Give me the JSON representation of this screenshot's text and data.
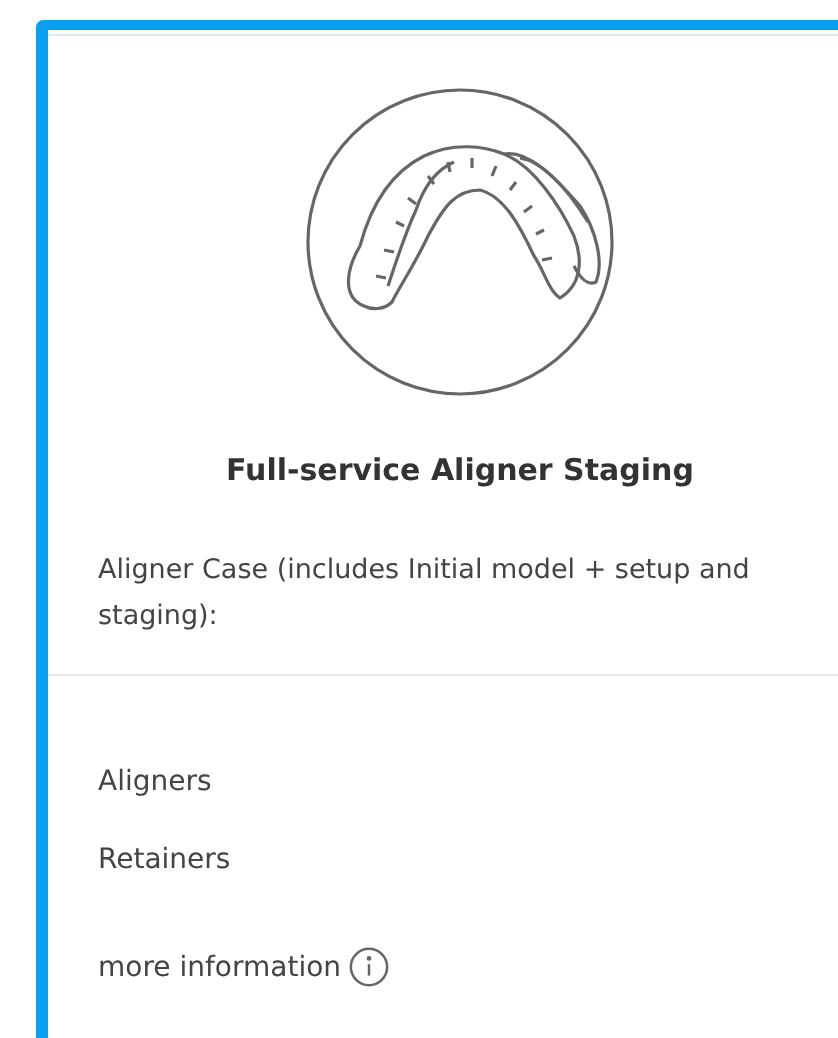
{
  "card": {
    "title": "Full-service Aligner Staging",
    "description": "Aligner Case (includes Initial model + setup and staging):",
    "items": [
      "Aligners",
      "Retainers"
    ],
    "more_link": {
      "label": "more information"
    }
  }
}
